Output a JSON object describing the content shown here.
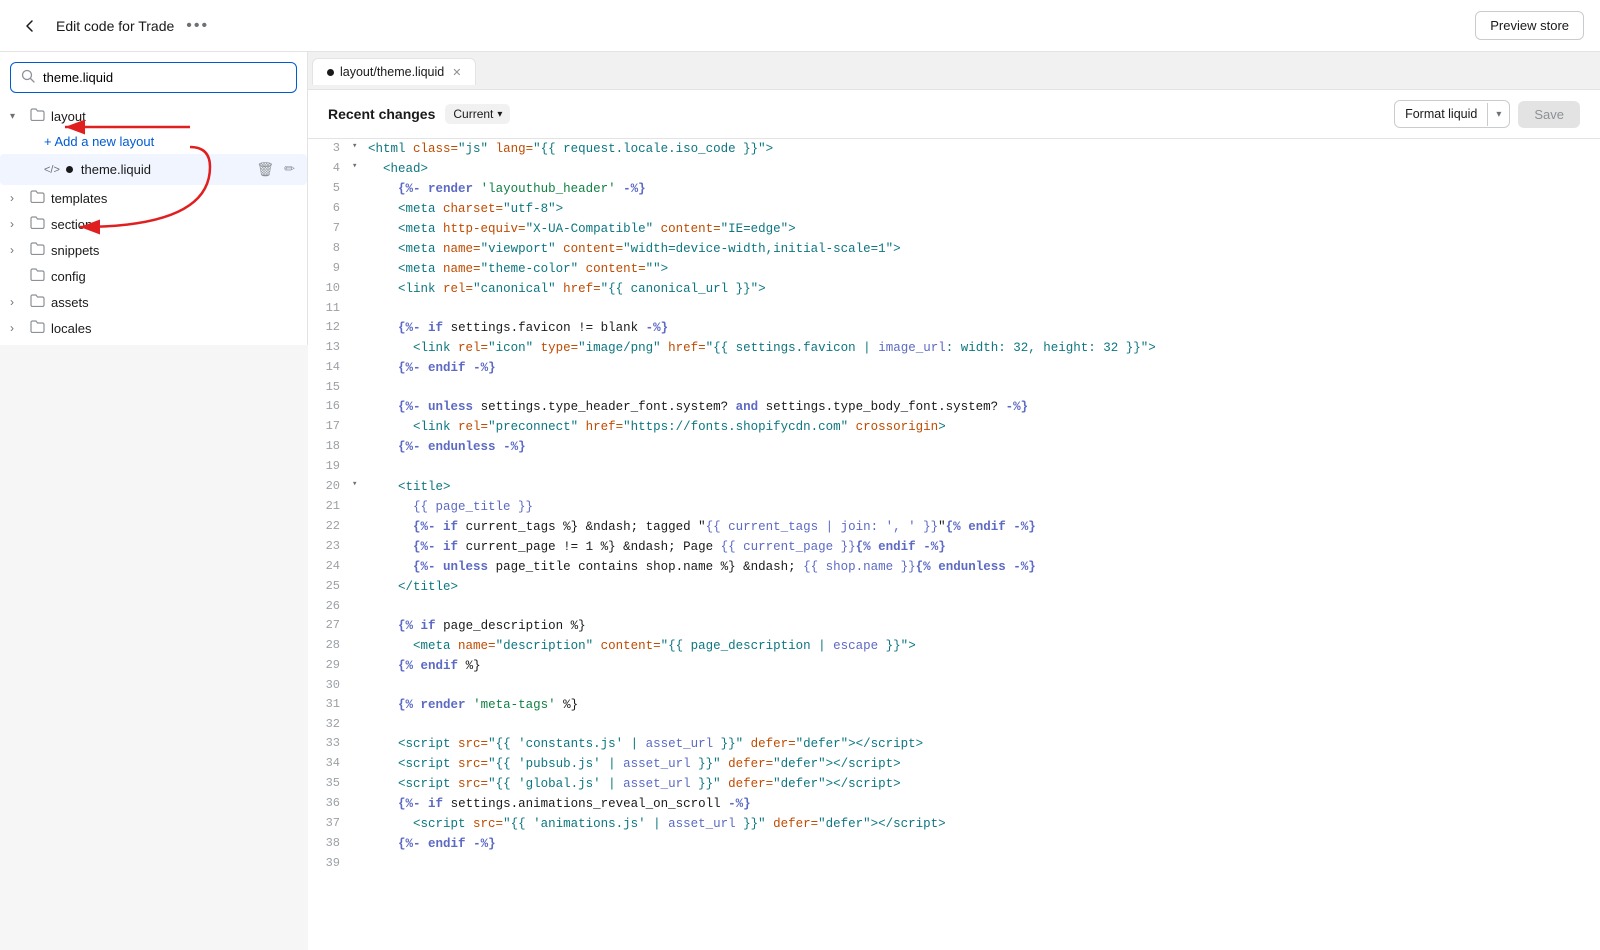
{
  "topbar": {
    "title": "Edit code for Trade",
    "preview_label": "Preview store",
    "more_icon": "•••"
  },
  "sidebar": {
    "search_value": "theme.liquid",
    "search_placeholder": "theme.liquid",
    "tree": [
      {
        "id": "layout",
        "label": "layout",
        "type": "folder",
        "expanded": true,
        "indent": 0,
        "chevron": "▾"
      },
      {
        "id": "add-layout",
        "label": "Add a new layout",
        "type": "add-link",
        "indent": 1
      },
      {
        "id": "theme-liquid",
        "label": "theme.liquid",
        "type": "file",
        "indent": 1,
        "active": true,
        "dot": true
      },
      {
        "id": "templates",
        "label": "templates",
        "type": "folder",
        "expanded": false,
        "indent": 0,
        "chevron": "›"
      },
      {
        "id": "sections",
        "label": "sections",
        "type": "folder",
        "expanded": false,
        "indent": 0,
        "chevron": "›"
      },
      {
        "id": "snippets",
        "label": "snippets",
        "type": "folder",
        "expanded": false,
        "indent": 0,
        "chevron": "›"
      },
      {
        "id": "config",
        "label": "config",
        "type": "folder",
        "expanded": false,
        "indent": 0,
        "chevron": ""
      },
      {
        "id": "assets",
        "label": "assets",
        "type": "folder",
        "expanded": false,
        "indent": 0,
        "chevron": "›"
      },
      {
        "id": "locales",
        "label": "locales",
        "type": "folder",
        "expanded": false,
        "indent": 0,
        "chevron": "›"
      }
    ]
  },
  "editor": {
    "tab_name": "layout/theme.liquid",
    "recent_changes_label": "Recent changes",
    "current_label": "Current",
    "format_liquid_label": "Format liquid",
    "save_label": "Save",
    "lines": [
      {
        "num": 3,
        "chevron": "▾",
        "html": "<span class='c-tag'>&lt;html</span> <span class='c-attr'>class=</span><span class='c-val'>\"js\"</span> <span class='c-attr'>lang=</span><span class='c-val'>\"{{ request.locale.iso_code }}\"</span><span class='c-tag'>&gt;</span>"
      },
      {
        "num": 4,
        "chevron": "▾",
        "html": "  <span class='c-tag'>&lt;head&gt;</span>"
      },
      {
        "num": 5,
        "chevron": "",
        "html": "    <span class='c-keyword'>{%-</span> <span class='c-keyword'>render</span> <span class='c-string'>'layouthub_header'</span> <span class='c-keyword'>-%}</span>"
      },
      {
        "num": 6,
        "chevron": "",
        "html": "    <span class='c-tag'>&lt;meta</span> <span class='c-attr'>charset=</span><span class='c-val'>\"utf-8\"</span><span class='c-tag'>&gt;</span>"
      },
      {
        "num": 7,
        "chevron": "",
        "html": "    <span class='c-tag'>&lt;meta</span> <span class='c-attr'>http-equiv=</span><span class='c-val'>\"X-UA-Compatible\"</span> <span class='c-attr'>content=</span><span class='c-val'>\"IE=edge\"</span><span class='c-tag'>&gt;</span>"
      },
      {
        "num": 8,
        "chevron": "",
        "html": "    <span class='c-tag'>&lt;meta</span> <span class='c-attr'>name=</span><span class='c-val'>\"viewport\"</span> <span class='c-attr'>content=</span><span class='c-val'>\"width=device-width,initial-scale=1\"</span><span class='c-tag'>&gt;</span>"
      },
      {
        "num": 9,
        "chevron": "",
        "html": "    <span class='c-tag'>&lt;meta</span> <span class='c-attr'>name=</span><span class='c-val'>\"theme-color\"</span> <span class='c-attr'>content=</span><span class='c-val'>\"\"</span><span class='c-tag'>&gt;</span>"
      },
      {
        "num": 10,
        "chevron": "",
        "html": "    <span class='c-tag'>&lt;link</span> <span class='c-attr'>rel=</span><span class='c-val'>\"canonical\"</span> <span class='c-attr'>href=</span><span class='c-val'>\"{{ canonical_url }}\"</span><span class='c-tag'>&gt;</span>"
      },
      {
        "num": 11,
        "chevron": "",
        "html": ""
      },
      {
        "num": 12,
        "chevron": "",
        "html": "    <span class='c-keyword'>{%-</span> <span class='c-keyword'>if</span> settings.favicon != blank <span class='c-keyword'>-%}</span>"
      },
      {
        "num": 13,
        "chevron": "",
        "html": "      <span class='c-tag'>&lt;link</span> <span class='c-attr'>rel=</span><span class='c-val'>\"icon\"</span> <span class='c-attr'>type=</span><span class='c-val'>\"image/png\"</span> <span class='c-attr'>href=</span><span class='c-val'>\"{{ settings.favicon | <span class='c-liquid-filter'>image_url</span>: width: 32, height: 32 }}\"</span><span class='c-tag'>&gt;</span>"
      },
      {
        "num": 14,
        "chevron": "",
        "html": "    <span class='c-keyword'>{%-</span> <span class='c-keyword'>endif</span> <span class='c-keyword'>-%}</span>"
      },
      {
        "num": 15,
        "chevron": "",
        "html": ""
      },
      {
        "num": 16,
        "chevron": "",
        "html": "    <span class='c-keyword'>{%-</span> <span class='c-keyword'>unless</span> settings.type_header_font.system? <span class='c-keyword'>and</span> settings.type_body_font.system? <span class='c-keyword'>-%}</span>"
      },
      {
        "num": 17,
        "chevron": "",
        "html": "      <span class='c-tag'>&lt;link</span> <span class='c-attr'>rel=</span><span class='c-val'>\"preconnect\"</span> <span class='c-attr'>href=</span><span class='c-val'>\"https://fonts.shopifycdn.com\"</span> <span class='c-attr'>crossorigin</span><span class='c-tag'>&gt;</span>"
      },
      {
        "num": 18,
        "chevron": "",
        "html": "    <span class='c-keyword'>{%-</span> <span class='c-keyword'>endunless</span> <span class='c-keyword'>-%}</span>"
      },
      {
        "num": 19,
        "chevron": "",
        "html": ""
      },
      {
        "num": 20,
        "chevron": "▾",
        "html": "    <span class='c-tag'>&lt;title&gt;</span>"
      },
      {
        "num": 21,
        "chevron": "",
        "html": "      <span class='c-liquid'>{{ page_title }}</span>"
      },
      {
        "num": 22,
        "chevron": "",
        "html": "      <span class='c-keyword'>{%-</span> <span class='c-keyword'>if</span> current_tags %} &amp;ndash; tagged \"<span class='c-liquid'>{{ current_tags | join: ', ' }}</span>\"<span class='c-keyword'>{%</span> <span class='c-keyword'>endif</span> <span class='c-keyword'>-%}</span>"
      },
      {
        "num": 23,
        "chevron": "",
        "html": "      <span class='c-keyword'>{%-</span> <span class='c-keyword'>if</span> current_page != 1 %} &amp;ndash; Page <span class='c-liquid'>{{ current_page }}</span><span class='c-keyword'>{%</span> <span class='c-keyword'>endif</span> <span class='c-keyword'>-%}</span>"
      },
      {
        "num": 24,
        "chevron": "",
        "html": "      <span class='c-keyword'>{%-</span> <span class='c-keyword'>unless</span> page_title contains shop.name %} &amp;ndash; <span class='c-liquid'>{{ shop.name }}</span><span class='c-keyword'>{%</span> <span class='c-keyword'>endunless</span> <span class='c-keyword'>-%}</span>"
      },
      {
        "num": 25,
        "chevron": "",
        "html": "    <span class='c-tag'>&lt;/title&gt;</span>"
      },
      {
        "num": 26,
        "chevron": "",
        "html": ""
      },
      {
        "num": 27,
        "chevron": "",
        "html": "    <span class='c-keyword'>{%</span> <span class='c-keyword'>if</span> page_description %}"
      },
      {
        "num": 28,
        "chevron": "",
        "html": "      <span class='c-tag'>&lt;meta</span> <span class='c-attr'>name=</span><span class='c-val'>\"description\"</span> <span class='c-attr'>content=</span><span class='c-val'>\"{{ page_description | <span class='c-liquid-filter'>escape</span> }}\"</span><span class='c-tag'>&gt;</span>"
      },
      {
        "num": 29,
        "chevron": "",
        "html": "    <span class='c-keyword'>{%</span> <span class='c-keyword'>endif</span> %}"
      },
      {
        "num": 30,
        "chevron": "",
        "html": ""
      },
      {
        "num": 31,
        "chevron": "",
        "html": "    <span class='c-keyword'>{%</span> <span class='c-keyword'>render</span> <span class='c-string'>'meta-tags'</span> %}"
      },
      {
        "num": 32,
        "chevron": "",
        "html": ""
      },
      {
        "num": 33,
        "chevron": "",
        "html": "    <span class='c-tag'>&lt;script</span> <span class='c-attr'>src=</span><span class='c-val'>\"{{ 'constants.js' | <span class='c-liquid-filter'>asset_url</span> }}\"</span> <span class='c-attr'>defer=</span><span class='c-val'>\"defer\"</span><span class='c-tag'>&gt;&lt;/script&gt;</span>"
      },
      {
        "num": 34,
        "chevron": "",
        "html": "    <span class='c-tag'>&lt;script</span> <span class='c-attr'>src=</span><span class='c-val'>\"{{ 'pubsub.js' | <span class='c-liquid-filter'>asset_url</span> }}\"</span> <span class='c-attr'>defer=</span><span class='c-val'>\"defer\"</span><span class='c-tag'>&gt;&lt;/script&gt;</span>"
      },
      {
        "num": 35,
        "chevron": "",
        "html": "    <span class='c-tag'>&lt;script</span> <span class='c-attr'>src=</span><span class='c-val'>\"{{ 'global.js' | <span class='c-liquid-filter'>asset_url</span> }}\"</span> <span class='c-attr'>defer=</span><span class='c-val'>\"defer\"</span><span class='c-tag'>&gt;&lt;/script&gt;</span>"
      },
      {
        "num": 36,
        "chevron": "",
        "html": "    <span class='c-keyword'>{%-</span> <span class='c-keyword'>if</span> settings.animations_reveal_on_scroll <span class='c-keyword'>-%}</span>"
      },
      {
        "num": 37,
        "chevron": "",
        "html": "      <span class='c-tag'>&lt;script</span> <span class='c-attr'>src=</span><span class='c-val'>\"{{ 'animations.js' | <span class='c-liquid-filter'>asset_url</span> }}\"</span> <span class='c-attr'>defer=</span><span class='c-val'>\"defer\"</span><span class='c-tag'>&gt;&lt;/script&gt;</span>"
      },
      {
        "num": 38,
        "chevron": "",
        "html": "    <span class='c-keyword'>{%-</span> <span class='c-keyword'>endif</span> <span class='c-keyword'>-%}</span>"
      },
      {
        "num": 39,
        "chevron": "",
        "html": ""
      }
    ]
  }
}
